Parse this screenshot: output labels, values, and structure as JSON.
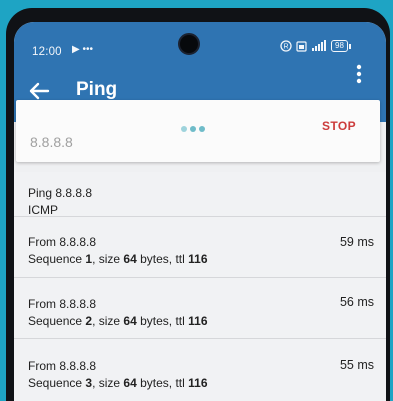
{
  "status": {
    "time": "12:00",
    "extra": "▶ •••",
    "battery": "98"
  },
  "app": {
    "title": "Ping"
  },
  "search": {
    "value": "",
    "placeholder": "8.8.8.8",
    "stop_label": "STOP"
  },
  "header_item": {
    "title": "Ping 8.8.8.8",
    "protocol": "ICMP"
  },
  "results": [
    {
      "from": "From 8.8.8.8",
      "seq_label": "Sequence ",
      "seq": "1",
      "size_label": ", size ",
      "size": "64",
      "bytes_label": " bytes, ttl ",
      "ttl": "116",
      "time": "59 ms"
    },
    {
      "from": "From 8.8.8.8",
      "seq_label": "Sequence ",
      "seq": "2",
      "size_label": ", size ",
      "size": "64",
      "bytes_label": " bytes, ttl ",
      "ttl": "116",
      "time": "56 ms"
    },
    {
      "from": "From 8.8.8.8",
      "seq_label": "Sequence ",
      "seq": "3",
      "size_label": ", size ",
      "size": "64",
      "bytes_label": " bytes, ttl ",
      "ttl": "116",
      "time": "55 ms"
    }
  ],
  "colors": {
    "app_bar": "#2f74b2",
    "stop": "#cc3b3b",
    "progress_dots": "#6fbcc9"
  }
}
